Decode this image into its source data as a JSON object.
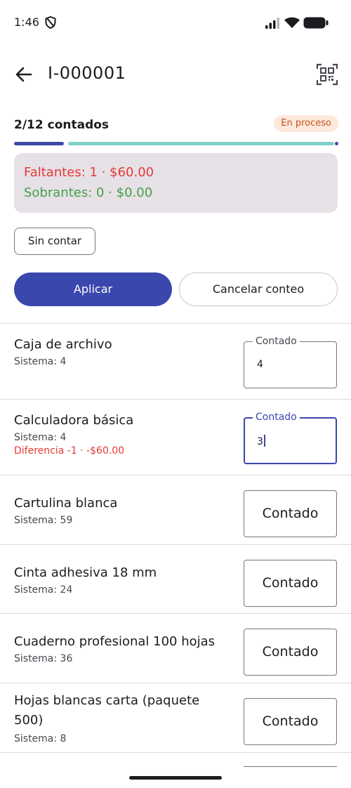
{
  "status_bar": {
    "time": "1:46"
  },
  "header": {
    "title": "I-000001",
    "back_icon": "arrow-back-icon",
    "qr_icon": "qr-scan-icon"
  },
  "progress": {
    "text": "2/12 contados",
    "status": "En proceso",
    "counted": 2,
    "total": 12,
    "colors": {
      "fill": "#3c4aa6",
      "rest": "#7fd0c7"
    }
  },
  "summary": {
    "missing": "Faltantes: 1 · $60.00",
    "extra": "Sobrantes: 0 · $0.00"
  },
  "filters": {
    "uncounted_label": "Sin contar"
  },
  "actions": {
    "apply_label": "Aplicar",
    "cancel_label": "Cancelar conteo"
  },
  "count_field_label": "Contado",
  "items": [
    {
      "name": "Caja de archivo",
      "system": "Sistema: 4",
      "diff": "",
      "value": "4"
    },
    {
      "name": "Calculadora básica",
      "system": "Sistema: 4",
      "diff": "Diferencia -1 · -$60.00",
      "value": "3"
    },
    {
      "name": "Cartulina blanca",
      "system": "Sistema: 59",
      "diff": "",
      "value": ""
    },
    {
      "name": "Cinta adhesiva 18 mm",
      "system": "Sistema: 24",
      "diff": "",
      "value": ""
    },
    {
      "name": "Cuaderno profesional 100 hojas",
      "system": "Sistema: 36",
      "diff": "",
      "value": ""
    },
    {
      "name": "Hojas blancas carta (paquete 500)",
      "system": "Sistema: 8",
      "diff": "",
      "value": ""
    }
  ]
}
